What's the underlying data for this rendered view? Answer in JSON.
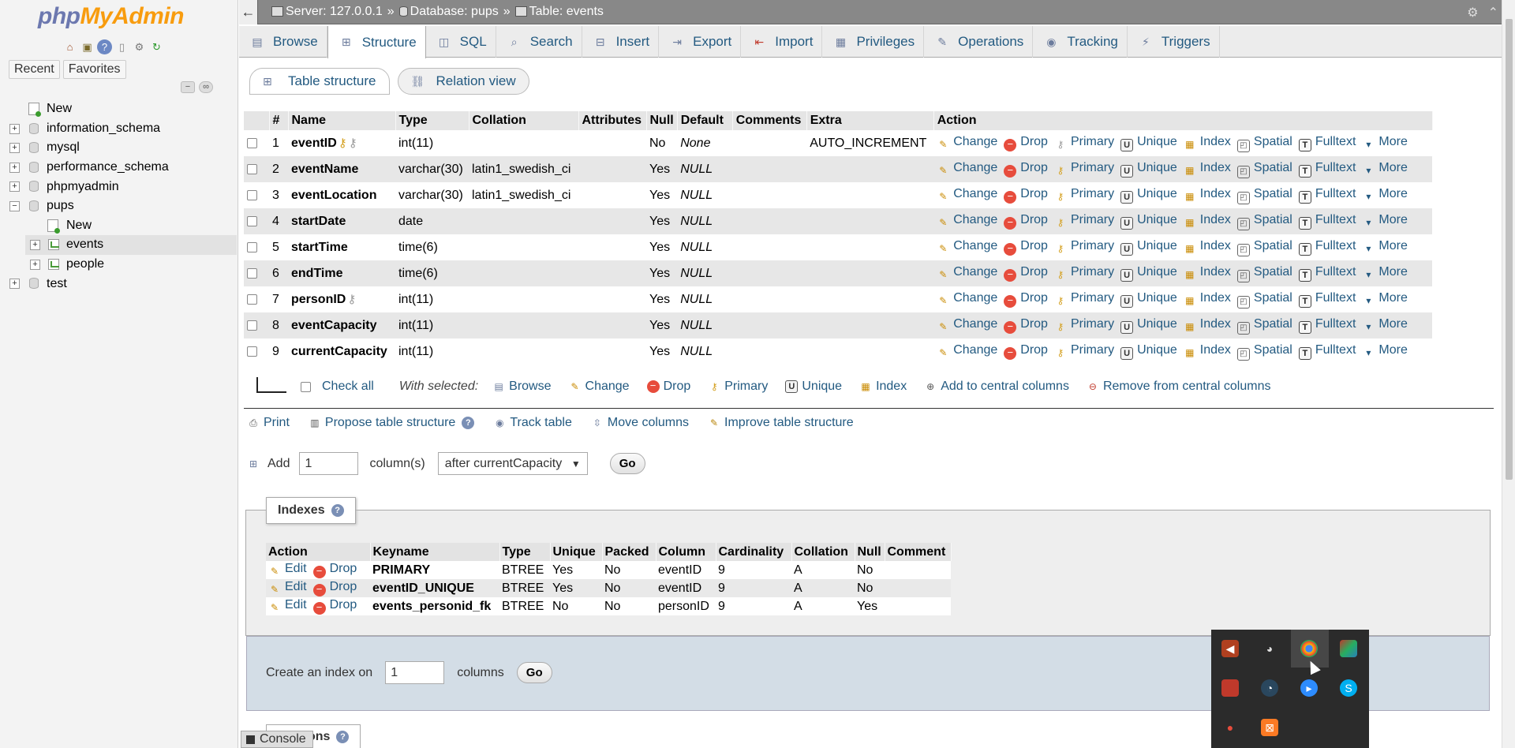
{
  "nav": {
    "logo_php": "php",
    "logo_myadmin": "MyAdmin",
    "tabs": [
      "Recent",
      "Favorites"
    ],
    "tree": [
      {
        "label": "New",
        "level": 1,
        "icon": "new"
      },
      {
        "label": "information_schema",
        "level": 0,
        "icon": "db"
      },
      {
        "label": "mysql",
        "level": 0,
        "icon": "db"
      },
      {
        "label": "performance_schema",
        "level": 0,
        "icon": "db"
      },
      {
        "label": "phpmyadmin",
        "level": 0,
        "icon": "db"
      },
      {
        "label": "pups",
        "level": 0,
        "icon": "db",
        "expanded": true
      },
      {
        "label": "New",
        "level": 2,
        "icon": "new"
      },
      {
        "label": "events",
        "level": 2,
        "icon": "table",
        "selected": true
      },
      {
        "label": "people",
        "level": 2,
        "icon": "table"
      },
      {
        "label": "test",
        "level": 0,
        "icon": "db"
      }
    ]
  },
  "breadcrumb": {
    "server": "Server: 127.0.0.1",
    "database": "Database: pups",
    "table": "Table: events",
    "sep": "»"
  },
  "menu_tabs": [
    "Browse",
    "Structure",
    "SQL",
    "Search",
    "Insert",
    "Export",
    "Import",
    "Privileges",
    "Operations",
    "Tracking",
    "Triggers"
  ],
  "active_tab": "Structure",
  "sub_tabs": [
    "Table structure",
    "Relation view"
  ],
  "structure": {
    "headers": [
      "#",
      "Name",
      "Type",
      "Collation",
      "Attributes",
      "Null",
      "Default",
      "Comments",
      "Extra",
      "Action"
    ],
    "rows": [
      {
        "num": "1",
        "name": "eventID",
        "type": "int(11)",
        "collation": "",
        "attributes": "",
        "null": "No",
        "default": "None",
        "comments": "",
        "extra": "AUTO_INCREMENT",
        "keys": "primary"
      },
      {
        "num": "2",
        "name": "eventName",
        "type": "varchar(30)",
        "collation": "latin1_swedish_ci",
        "attributes": "",
        "null": "Yes",
        "default": "NULL",
        "comments": "",
        "extra": "",
        "keys": ""
      },
      {
        "num": "3",
        "name": "eventLocation",
        "type": "varchar(30)",
        "collation": "latin1_swedish_ci",
        "attributes": "",
        "null": "Yes",
        "default": "NULL",
        "comments": "",
        "extra": "",
        "keys": ""
      },
      {
        "num": "4",
        "name": "startDate",
        "type": "date",
        "collation": "",
        "attributes": "",
        "null": "Yes",
        "default": "NULL",
        "comments": "",
        "extra": "",
        "keys": ""
      },
      {
        "num": "5",
        "name": "startTime",
        "type": "time(6)",
        "collation": "",
        "attributes": "",
        "null": "Yes",
        "default": "NULL",
        "comments": "",
        "extra": "",
        "keys": ""
      },
      {
        "num": "6",
        "name": "endTime",
        "type": "time(6)",
        "collation": "",
        "attributes": "",
        "null": "Yes",
        "default": "NULL",
        "comments": "",
        "extra": "",
        "keys": ""
      },
      {
        "num": "7",
        "name": "personID",
        "type": "int(11)",
        "collation": "",
        "attributes": "",
        "null": "Yes",
        "default": "NULL",
        "comments": "",
        "extra": "",
        "keys": "index"
      },
      {
        "num": "8",
        "name": "eventCapacity",
        "type": "int(11)",
        "collation": "",
        "attributes": "",
        "null": "Yes",
        "default": "NULL",
        "comments": "",
        "extra": "",
        "keys": ""
      },
      {
        "num": "9",
        "name": "currentCapacity",
        "type": "int(11)",
        "collation": "",
        "attributes": "",
        "null": "Yes",
        "default": "NULL",
        "comments": "",
        "extra": "",
        "keys": ""
      }
    ],
    "row_actions": [
      "Change",
      "Drop",
      "Primary",
      "Unique",
      "Index",
      "Spatial",
      "Fulltext",
      "More"
    ]
  },
  "with_selected": {
    "check_all": "Check all",
    "label": "With selected:",
    "actions": [
      "Browse",
      "Change",
      "Drop",
      "Primary",
      "Unique",
      "Index",
      "Add to central columns",
      "Remove from central columns"
    ]
  },
  "utilities": [
    "Print",
    "Propose table structure",
    "Track table",
    "Move columns",
    "Improve table structure"
  ],
  "add_columns": {
    "label": "Add",
    "value": "1",
    "unit": "column(s)",
    "position": "after currentCapacity",
    "go": "Go"
  },
  "indexes": {
    "legend": "Indexes",
    "headers": [
      "Action",
      "Keyname",
      "Type",
      "Unique",
      "Packed",
      "Column",
      "Cardinality",
      "Collation",
      "Null",
      "Comment"
    ],
    "edit": "Edit",
    "drop": "Drop",
    "rows": [
      {
        "keyname": "PRIMARY",
        "type": "BTREE",
        "unique": "Yes",
        "packed": "No",
        "column": "eventID",
        "cardinality": "9",
        "collation": "A",
        "null": "No",
        "comment": ""
      },
      {
        "keyname": "eventID_UNIQUE",
        "type": "BTREE",
        "unique": "Yes",
        "packed": "No",
        "column": "eventID",
        "cardinality": "9",
        "collation": "A",
        "null": "No",
        "comment": ""
      },
      {
        "keyname": "events_personid_fk",
        "type": "BTREE",
        "unique": "No",
        "packed": "No",
        "column": "personID",
        "cardinality": "9",
        "collation": "A",
        "null": "Yes",
        "comment": ""
      }
    ],
    "create_label": "Create an index on",
    "create_value": "1",
    "create_unit": "columns",
    "go": "Go"
  },
  "partitions_legend": "ons",
  "console": "Console",
  "tray_icons": [
    "speaker-icon",
    "discord-icon",
    "chrome-icon",
    "app-icon",
    "acrobat-icon",
    "steam-icon",
    "zoom-icon",
    "skype-icon",
    "app2-icon",
    "xampp-icon"
  ],
  "colors": {
    "link": "#235a81",
    "accent": "#f89c0e",
    "logo": "#6c78af"
  }
}
